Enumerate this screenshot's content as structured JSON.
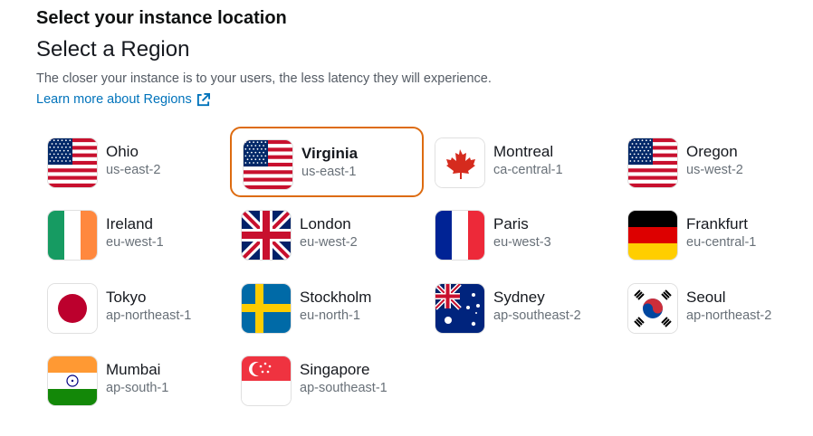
{
  "header": {
    "title": "Select your instance location",
    "subtitle": "Select a Region",
    "description": "The closer your instance is to your users, the less latency they will experience.",
    "learn_more": "Learn more about Regions",
    "learn_more_icon": "external-link-icon"
  },
  "accent_color": "#dd6b10",
  "link_color": "#0073bb",
  "regions": [
    {
      "name": "Ohio",
      "code": "us-east-2",
      "flag": "us-flag-icon"
    },
    {
      "name": "Virginia",
      "code": "us-east-1",
      "flag": "us-flag-icon",
      "selected": true
    },
    {
      "name": "Montreal",
      "code": "ca-central-1",
      "flag": "canada-flag-icon"
    },
    {
      "name": "Oregon",
      "code": "us-west-2",
      "flag": "us-flag-icon"
    },
    {
      "name": "Ireland",
      "code": "eu-west-1",
      "flag": "ireland-flag-icon"
    },
    {
      "name": "London",
      "code": "eu-west-2",
      "flag": "uk-flag-icon"
    },
    {
      "name": "Paris",
      "code": "eu-west-3",
      "flag": "france-flag-icon"
    },
    {
      "name": "Frankfurt",
      "code": "eu-central-1",
      "flag": "germany-flag-icon"
    },
    {
      "name": "Tokyo",
      "code": "ap-northeast-1",
      "flag": "japan-flag-icon"
    },
    {
      "name": "Stockholm",
      "code": "eu-north-1",
      "flag": "sweden-flag-icon"
    },
    {
      "name": "Sydney",
      "code": "ap-southeast-2",
      "flag": "australia-flag-icon"
    },
    {
      "name": "Seoul",
      "code": "ap-northeast-2",
      "flag": "korea-flag-icon"
    },
    {
      "name": "Mumbai",
      "code": "ap-south-1",
      "flag": "india-flag-icon"
    },
    {
      "name": "Singapore",
      "code": "ap-southeast-1",
      "flag": "singapore-flag-icon"
    }
  ]
}
